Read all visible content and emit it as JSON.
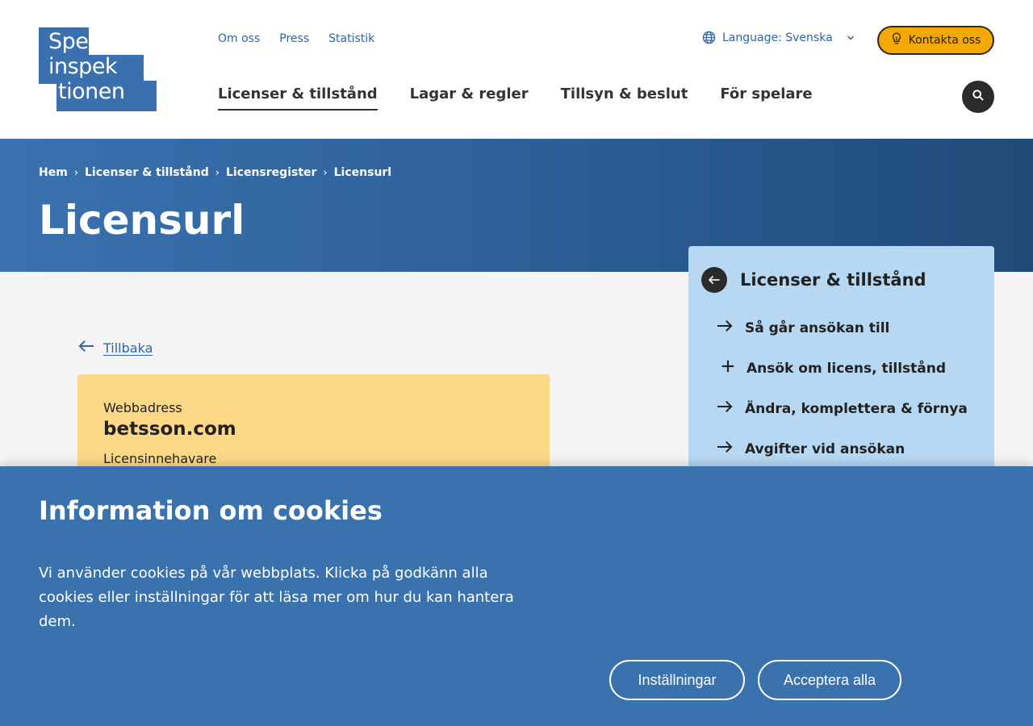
{
  "logo": {
    "lines": [
      "Spel",
      "inspek",
      "tionen"
    ]
  },
  "top_links": [
    "Om oss",
    "Press",
    "Statistik"
  ],
  "language": {
    "label": "Language: Svenska"
  },
  "contact": {
    "label": "Kontakta oss"
  },
  "main_nav": [
    {
      "label": "Licenser & tillstånd",
      "active": true
    },
    {
      "label": "Lagar & regler"
    },
    {
      "label": "Tillsyn & beslut"
    },
    {
      "label": "För spelare"
    }
  ],
  "breadcrumb": [
    "Hem",
    "Licenser & tillstånd",
    "Licensregister",
    "Licensurl"
  ],
  "page": {
    "title": "Licensurl",
    "back_label": "Tillbaka"
  },
  "card": {
    "web_label": "Webbadress",
    "web_value": "betsson.com",
    "next_label": "Licensinnehavare"
  },
  "side_panel": {
    "title": "Licenser & tillstånd",
    "items": [
      {
        "label": "Så går ansökan till",
        "icon": "arrow-right-icon"
      },
      {
        "label": "Ansök om licens, tillstånd",
        "icon": "plus-icon"
      },
      {
        "label": "Ändra, komplettera & förnya",
        "icon": "arrow-right-icon"
      },
      {
        "label": "Avgifter vid ansökan",
        "icon": "arrow-right-icon"
      }
    ]
  },
  "cookie": {
    "title": "Information om cookies",
    "text": "Vi använder cookies på vår webbplats. Klicka på godkänn alla cookies eller inställningar för att läsa mer om hur du kan hantera dem.",
    "settings_label": "Inställningar",
    "accept_label": "Acceptera alla"
  },
  "colors": {
    "brand_blue": "#3a70ad",
    "accent_yellow": "#f4a800",
    "card_yellow": "#fdd886",
    "panel_blue": "#b7d8f2"
  }
}
